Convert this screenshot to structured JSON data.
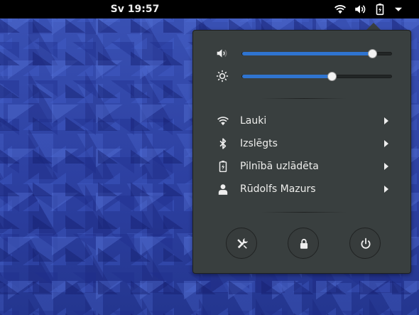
{
  "topbar": {
    "clock": "Sv 19:57",
    "tray_icons": [
      "wifi-icon",
      "volume-icon",
      "battery-icon",
      "dropdown-arrow-icon"
    ]
  },
  "menu": {
    "volume": {
      "icon": "volume-low-icon",
      "level": 0.87
    },
    "brightness": {
      "icon": "brightness-icon",
      "level": 0.6
    },
    "items": [
      {
        "icon": "wifi-icon",
        "label": "Lauki"
      },
      {
        "icon": "bluetooth-icon",
        "label": "Izslēgts"
      },
      {
        "icon": "battery-icon",
        "label": "Pilnībā uzlādēta"
      },
      {
        "icon": "user-icon",
        "label": "Rūdolfs Mazurs"
      }
    ],
    "actions": [
      "settings-icon",
      "lock-icon",
      "power-icon"
    ]
  },
  "colors": {
    "accent": "#2f74d0",
    "menu_bg": "#393f3f",
    "text": "#eeeeec",
    "topbar": "#000000"
  }
}
